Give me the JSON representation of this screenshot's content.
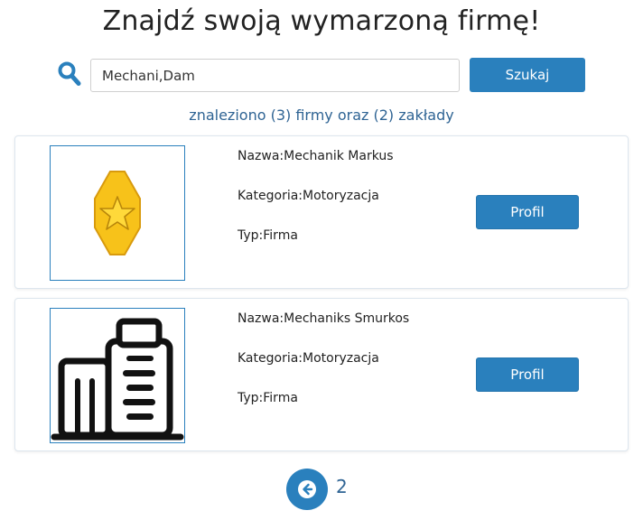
{
  "header": {
    "title": "Znajdź swoją wymarzoną firmę!"
  },
  "search": {
    "icon": "search-icon",
    "value": "Mechani,Dam",
    "button_label": "Szukaj"
  },
  "results": {
    "summary": "znaleziono (3) firmy oraz (2) zakłady",
    "items": [
      {
        "image_icon": "star-badge-icon",
        "name": "Nazwa:Mechanik Markus",
        "category": "Kategoria:Motoryzacja",
        "type": "Typ:Firma",
        "button_label": "Profil"
      },
      {
        "image_icon": "building-icon",
        "name": "Nazwa:Mechaniks Smurkos",
        "category": "Kategoria:Motoryzacja",
        "type": "Typ:Firma",
        "button_label": "Profil"
      }
    ]
  },
  "pagination": {
    "back_icon": "arrow-left-icon",
    "current_page": "2"
  },
  "colors": {
    "accent": "#2a80bd",
    "summary_text": "#2f6494",
    "badge_gold": "#f7c21a"
  }
}
